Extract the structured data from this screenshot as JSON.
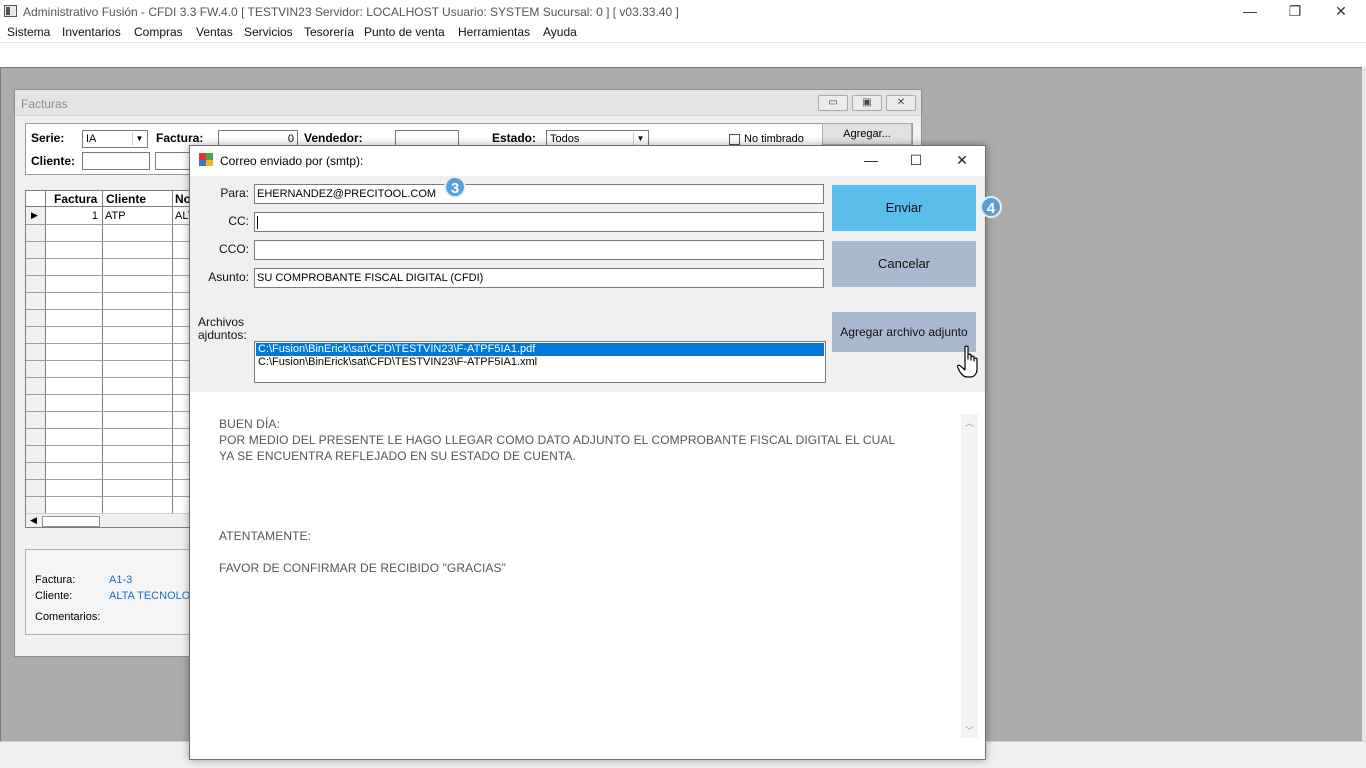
{
  "app": {
    "title": "Administrativo Fusión - CFDI 3.3 FW.4.0 [ TESTVIN23  Servidor: LOCALHOST   Usuario: SYSTEM     Sucursal: 0 ] [ v03.33.40 ]",
    "minimize": "—",
    "restore": "❐",
    "close": "✕"
  },
  "menu": [
    "Sistema",
    "Inventarios",
    "Compras",
    "Ventas",
    "Servicios",
    "Tesorería",
    "Punto de venta",
    "Herramientas",
    "Ayuda"
  ],
  "facturas": {
    "title": "Facturas",
    "ctrl_min": "▭",
    "ctrl_restore": "▣",
    "ctrl_close": "✕",
    "serie_label": "Serie:",
    "serie_value": "IA",
    "factura_label": "Factura:",
    "factura_value": "0",
    "vendedor_label": "Vendedor:",
    "estado_label": "Estado:",
    "estado_value": "Todos",
    "no_timbrado_label": "No timbrado",
    "agregar_label": "Agregar...",
    "cliente_label": "Cliente:",
    "grid_headers": [
      "Factura",
      "Cliente",
      "Nor"
    ],
    "row_indicator": "▶",
    "rows": [
      {
        "factura": "1",
        "cliente": "ATP",
        "nombre": "ALT"
      }
    ],
    "scroll_left": "◀",
    "info": {
      "factura_label": "Factura:",
      "factura_value": "A1-3",
      "cliente_label": "Cliente:",
      "cliente_value": "ALTA TECNOLOG",
      "comentarios_label": "Comentarios:"
    }
  },
  "dialog": {
    "title": "Correo enviado por (smtp):",
    "minimize": "—",
    "maximize": "☐",
    "close": "✕",
    "para_label": "Para:",
    "para_value": "EHERNANDEZ@PRECITOOL.COM",
    "cc_label": "CC:",
    "cc_value": "",
    "cco_label": "CCO:",
    "cco_value": "",
    "asunto_label": "Asunto:",
    "asunto_value": "SU COMPROBANTE FISCAL DIGITAL (CFDI)",
    "enviar_label": "Enviar",
    "cancelar_label": "Cancelar",
    "archivos_label_1": "Archivos",
    "archivos_label_2": "ajduntos:",
    "attachments": [
      "C:\\Fusion\\BinErick\\sat\\CFD\\TESTVIN23\\F-ATPF5IA1.pdf",
      "C:\\Fusion\\BinErick\\sat\\CFD\\TESTVIN23\\F-ATPF5IA1.xml"
    ],
    "agregar_adjunto_label": "Agregar archivo adjunto",
    "message_lines": [
      "BUEN DÍA:",
      "POR MEDIO DEL PRESENTE LE HAGO LLEGAR COMO DATO ADJUNTO EL COMPROBANTE FISCAL DIGITAL  EL  CUAL",
      "YA SE ENCUENTRA REFLEJADO EN SU ESTADO DE CUENTA.",
      "ATENTAMENTE:",
      "FAVOR DE CONFIRMAR DE RECIBIDO \"GRACIAS\""
    ],
    "scroll_up": "︿",
    "scroll_down": "﹀",
    "step_badges": [
      "3",
      "4"
    ]
  },
  "colors": {
    "enviar_bg": "#5bbde9",
    "cancelar_bg": "#a9b9cf",
    "agregar_adjunto_bg": "#a9b9cf",
    "selection_bg": "#0078d7",
    "link_blue": "#1a6fc4",
    "badge_bg": "#5aa0d8"
  }
}
